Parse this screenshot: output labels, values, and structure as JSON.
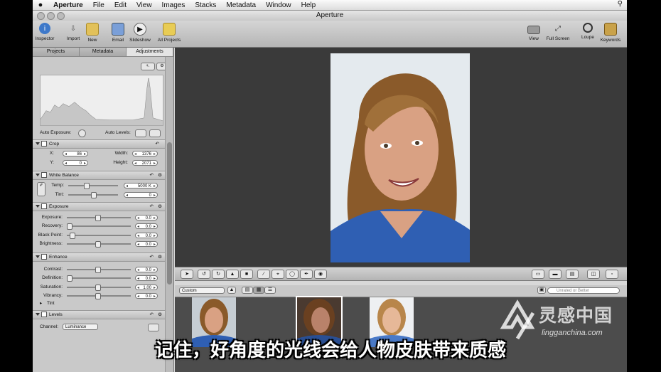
{
  "menubar": {
    "app": "Aperture",
    "items": [
      "File",
      "Edit",
      "View",
      "Images",
      "Stacks",
      "Metadata",
      "Window",
      "Help"
    ]
  },
  "window": {
    "title": "Aperture"
  },
  "toolbar": {
    "left": [
      "Inspector",
      "Import",
      "New",
      "Email",
      "Slideshow",
      "All Projects"
    ],
    "right": [
      "View",
      "Full Screen",
      "Loupe",
      "Keywords"
    ]
  },
  "inspector": {
    "tabs": [
      "Projects",
      "Metadata",
      "Adjustments"
    ],
    "active_tab": "Adjustments",
    "auto_exposure": "Auto Exposure:",
    "auto_levels": "Auto Levels:",
    "crop": {
      "title": "Crop",
      "x_label": "X:",
      "x": "86",
      "y_label": "Y:",
      "y": "0",
      "width_label": "Width:",
      "width": "1376",
      "height_label": "Height:",
      "height": "2071"
    },
    "white_balance": {
      "title": "White Balance",
      "temp_label": "Temp:",
      "temp": "5000 K",
      "tint_label": "Tint:",
      "tint": "0"
    },
    "exposure": {
      "title": "Exposure",
      "rows": [
        {
          "label": "Exposure:",
          "value": "0.0"
        },
        {
          "label": "Recovery:",
          "value": "0.0"
        },
        {
          "label": "Black Point:",
          "value": "0.0"
        },
        {
          "label": "Brightness:",
          "value": "0.0"
        }
      ]
    },
    "enhance": {
      "title": "Enhance",
      "rows": [
        {
          "label": "Contrast:",
          "value": "0.0"
        },
        {
          "label": "Definition:",
          "value": "0.0"
        },
        {
          "label": "Saturation:",
          "value": "1.00"
        },
        {
          "label": "Vibrancy:",
          "value": "0.0"
        }
      ],
      "tint": "Tint"
    },
    "levels": {
      "title": "Levels",
      "channel_label": "Channel:",
      "channel": "Luminance"
    }
  },
  "browser": {
    "sort": "Custom",
    "filter_placeholder": "Unrated or Better"
  },
  "subtitle": "记住，好角度的光线会给人物皮肤带来质感",
  "watermark": {
    "main": "灵感中国",
    "sub": "lingganchina.com"
  },
  "colors": {
    "viewer_bg": "#3a3a3a",
    "panel_bg": "#c9c9c9",
    "shirt": "#2f5fb3",
    "hair": "#8a5a2a"
  }
}
